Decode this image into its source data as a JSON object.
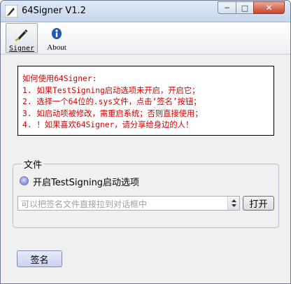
{
  "window": {
    "title": "64Signer V1.2"
  },
  "toolbar": {
    "signer_label": "Signer",
    "about_label": "About"
  },
  "instructions": {
    "lines": [
      "如何使用64Signer:",
      "1. 如果TestSigning启动选项未开启，开启它；",
      "2. 选择一个64位的.sys文件，点击‘签名’按钮；",
      "3. 如启动项被修改，需重启系统；否则直接使用；",
      "4. ！如果喜欢64Signer，请分享给身边的人！"
    ]
  },
  "file_group": {
    "title": "文件",
    "testsigning_label": "开启TestSigning启动选项",
    "file_placeholder": "可以把签名文件直接拉到对话框中",
    "open_label": "打开"
  },
  "actions": {
    "sign_label": "签名"
  },
  "colors": {
    "instruction_text": "#d40000"
  }
}
